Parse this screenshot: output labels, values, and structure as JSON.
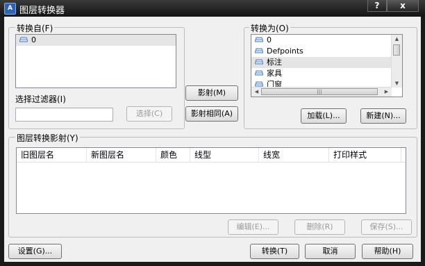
{
  "window": {
    "title": "图层转换器",
    "help_label": "?",
    "close_label": "x"
  },
  "from": {
    "group_label": "转换自(F)",
    "layers": [
      "0"
    ],
    "filter_label": "选择过滤器(I)",
    "filter_value": "",
    "select_button": "选择(C)"
  },
  "middle": {
    "map_button": "影射(M)",
    "map_same_button": "影射相同(A)"
  },
  "to": {
    "group_label": "转换为(O)",
    "layers": [
      "0",
      "Defpoints",
      "标注",
      "家具",
      "门窗"
    ],
    "load_button": "加载(L)...",
    "new_button": "新建(N)..."
  },
  "mapping": {
    "group_label": "图层转换影射(Y)",
    "columns": [
      "旧图层名",
      "新图层名",
      "颜色",
      "线型",
      "线宽",
      "打印样式"
    ],
    "edit_button": "编辑(E)...",
    "delete_button": "删除(R)",
    "save_button": "保存(S)..."
  },
  "footer": {
    "settings_button": "设置(G)...",
    "convert_button": "转换(T)",
    "cancel_button": "取消",
    "help_button": "帮助(H)"
  },
  "colors": {
    "title_bar": "#141414",
    "dialog_bg": "#f0f0f0",
    "selection": "#e5e5e5",
    "layer_icon": "#4a7cc8"
  }
}
